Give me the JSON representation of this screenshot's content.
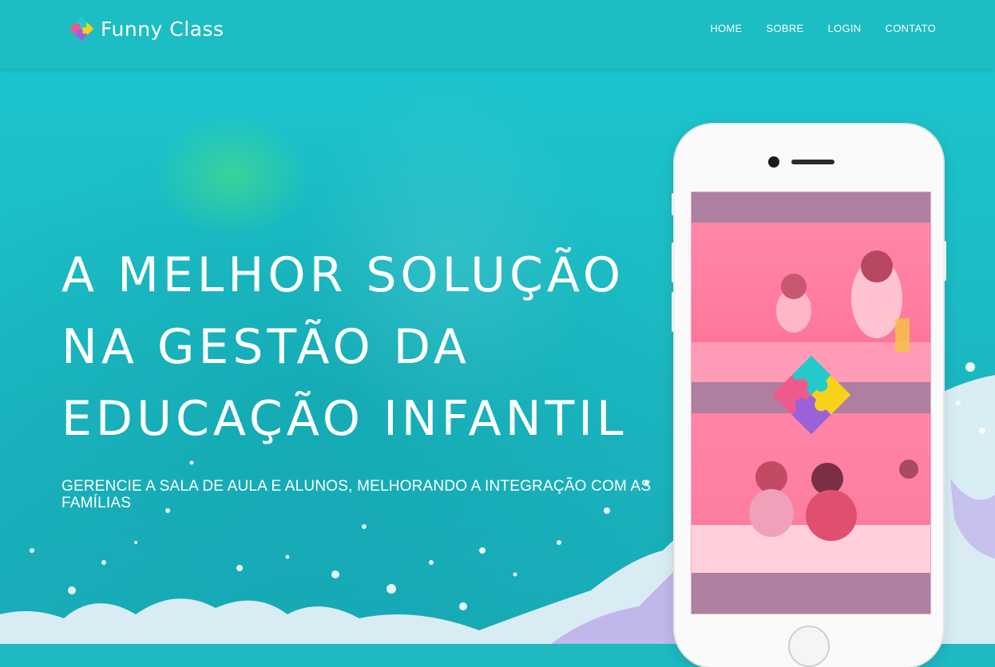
{
  "header": {
    "brand_name": "Funny Class",
    "nav": [
      "HOME",
      "SOBRE",
      "LOGIN",
      "CONTATO"
    ]
  },
  "hero": {
    "headline": [
      "A MELHOR SOLUÇÃO",
      "NA GESTÃO DA",
      "EDUCAÇÃO INFANTIL"
    ],
    "subline": "GERENCIE A SALA DE AULA E ALUNOS, MELHORANDO A INTEGRAÇÃO COM AS FAMÍLIAS"
  },
  "colors": {
    "brand_teal": "#1cbdc3",
    "puzzle_teal": "#25c9c9",
    "puzzle_yellow": "#f7d21b",
    "puzzle_pink": "#ef5a8d",
    "puzzle_purple": "#9a62d8",
    "phone_screen_tint": "#ae7fa0"
  },
  "icons": {
    "brand_logo": "puzzle-logo-icon",
    "screen_logo": "puzzle-logo-icon"
  }
}
